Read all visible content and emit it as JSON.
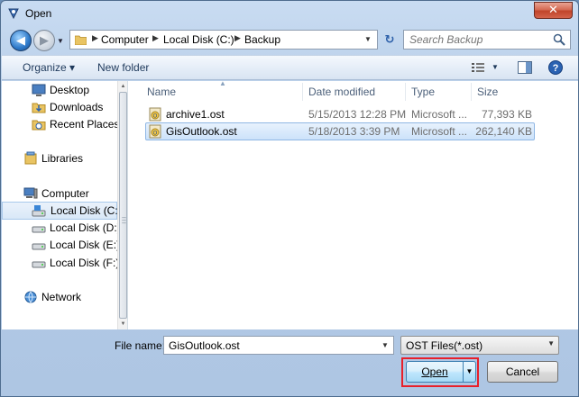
{
  "window": {
    "title": "Open",
    "close_glyph": "✕"
  },
  "address": {
    "crumbs": [
      "Computer",
      "Local Disk (C:)",
      "Backup"
    ],
    "search_placeholder": "Search Backup"
  },
  "toolbar": {
    "organize_label": "Organize ▾",
    "new_folder_label": "New folder"
  },
  "nav": {
    "items": [
      {
        "label": "Desktop",
        "icon": "desktop-icon"
      },
      {
        "label": "Downloads",
        "icon": "downloads-folder-icon"
      },
      {
        "label": "Recent Places",
        "icon": "recent-places-icon"
      },
      {
        "label": "Libraries",
        "icon": "libraries-icon"
      },
      {
        "label": "Computer",
        "icon": "computer-icon"
      },
      {
        "label": "Local Disk (C:)",
        "icon": "drive-icon"
      },
      {
        "label": "Local Disk (D:)",
        "icon": "drive-icon"
      },
      {
        "label": "Local Disk (E:)",
        "icon": "drive-icon"
      },
      {
        "label": "Local Disk (F:)",
        "icon": "drive-icon"
      },
      {
        "label": "Network",
        "icon": "network-icon"
      }
    ],
    "selected": "Local Disk (C:)"
  },
  "files": {
    "columns": [
      "Name",
      "Date modified",
      "Type",
      "Size"
    ],
    "rows": [
      {
        "name": "archive1.ost",
        "date": "5/15/2013 12:28 PM",
        "type": "Microsoft ...",
        "size": "77,393 KB"
      },
      {
        "name": "GisOutlook.ost",
        "date": "5/18/2013 3:39 PM",
        "type": "Microsoft ...",
        "size": "262,140 KB"
      }
    ],
    "selected": "GisOutlook.ost"
  },
  "bottom": {
    "filename_label": "File name:",
    "filename_value": "GisOutlook.ost",
    "filter_value": "OST Files(*.ost)",
    "open_label": "Open",
    "cancel_label": "Cancel"
  },
  "colors": {
    "accent": "#3c7fb1",
    "highlight_box": "#e8202a",
    "selection": "#cce2fa"
  }
}
